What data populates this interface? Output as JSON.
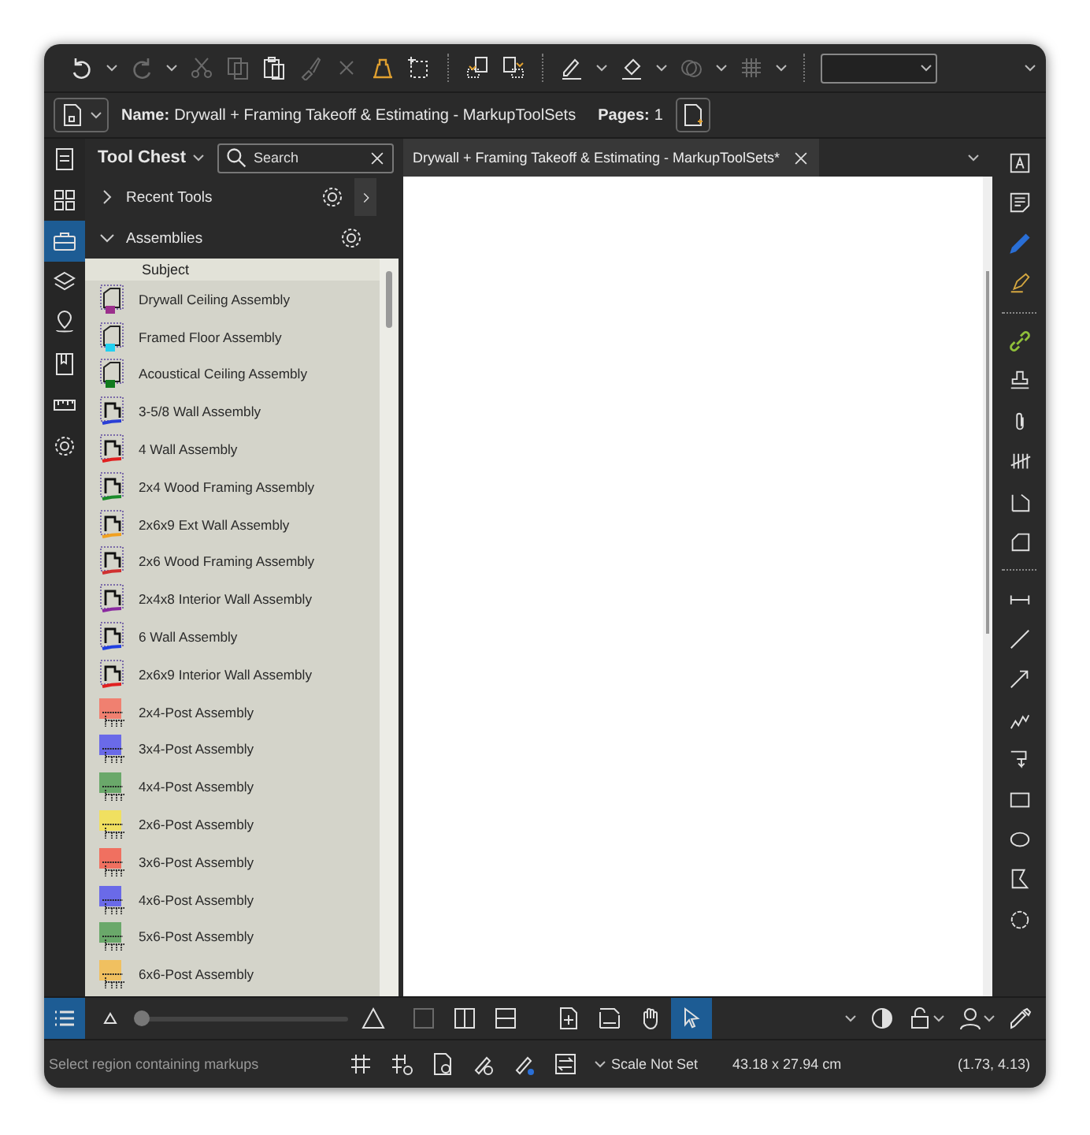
{
  "document": {
    "name_label": "Name:",
    "name": "Drywall + Framing Takeoff & Estimating - MarkupToolSets",
    "pages_label": "Pages:",
    "pages": "1"
  },
  "left_rail": [
    {
      "selected": false
    },
    {
      "selected": false
    },
    {
      "selected": true
    },
    {
      "selected": false
    },
    {
      "selected": false
    },
    {
      "selected": false
    },
    {
      "selected": false
    },
    {
      "selected": false
    }
  ],
  "tool_chest": {
    "title": "Tool Chest",
    "search": {
      "placeholder": "Search"
    },
    "sections": [
      {
        "label": "Recent Tools",
        "expanded": false
      },
      {
        "label": "Assemblies",
        "expanded": true
      }
    ],
    "column": "Subject",
    "items": [
      {
        "label": "Drywall Ceiling Assembly",
        "kind": "area",
        "color": "#9b2f8c"
      },
      {
        "label": "Framed Floor Assembly",
        "kind": "area",
        "color": "#22d0f0"
      },
      {
        "label": "Acoustical Ceiling Assembly",
        "kind": "area",
        "color": "#117a1e"
      },
      {
        "label": "3-5/8 Wall Assembly",
        "kind": "wall",
        "color": "#2a3fd6"
      },
      {
        "label": "4 Wall Assembly",
        "kind": "wall",
        "color": "#e02020"
      },
      {
        "label": "2x4 Wood Framing Assembly",
        "kind": "wall",
        "color": "#1a8a2a"
      },
      {
        "label": "2x6x9 Ext Wall Assembly",
        "kind": "wall",
        "color": "#f0a020"
      },
      {
        "label": "2x6 Wood Framing Assembly",
        "kind": "wall",
        "color": "#d03030"
      },
      {
        "label": "2x4x8 Interior Wall Assembly",
        "kind": "wall",
        "color": "#8a2aa0"
      },
      {
        "label": "6 Wall Assembly",
        "kind": "wall",
        "color": "#2040e0"
      },
      {
        "label": "2x6x9 Interior Wall Assembly",
        "kind": "wall",
        "color": "#e02020"
      },
      {
        "label": "2x4-Post Assembly",
        "kind": "post",
        "color": "#f08070"
      },
      {
        "label": "3x4-Post Assembly",
        "kind": "post",
        "color": "#6a6ae8"
      },
      {
        "label": "4x4-Post Assembly",
        "kind": "post",
        "color": "#6aa86a"
      },
      {
        "label": "2x6-Post Assembly",
        "kind": "post",
        "color": "#f0e060"
      },
      {
        "label": "3x6-Post Assembly",
        "kind": "post",
        "color": "#f07060"
      },
      {
        "label": "4x6-Post Assembly",
        "kind": "post",
        "color": "#6a6ae8"
      },
      {
        "label": "5x6-Post Assembly",
        "kind": "post",
        "color": "#6aa86a"
      },
      {
        "label": "6x6-Post Assembly",
        "kind": "post",
        "color": "#f0c060"
      }
    ],
    "size_slider": {
      "level": 0.03
    }
  },
  "tab": {
    "title": "Drywall + Framing Takeoff & Estimating - MarkupToolSets*"
  },
  "view_tools": [
    {
      "selected": false
    },
    {
      "selected": false
    },
    {
      "selected": false
    },
    {
      "selected": false
    },
    {
      "selected": false
    },
    {
      "selected": false
    },
    {
      "selected": true
    }
  ],
  "status": {
    "message": "Select region containing markups",
    "scale": "Scale Not Set",
    "size": "43.18 x 27.94 cm",
    "coords": "(1.73, 4.13)"
  }
}
